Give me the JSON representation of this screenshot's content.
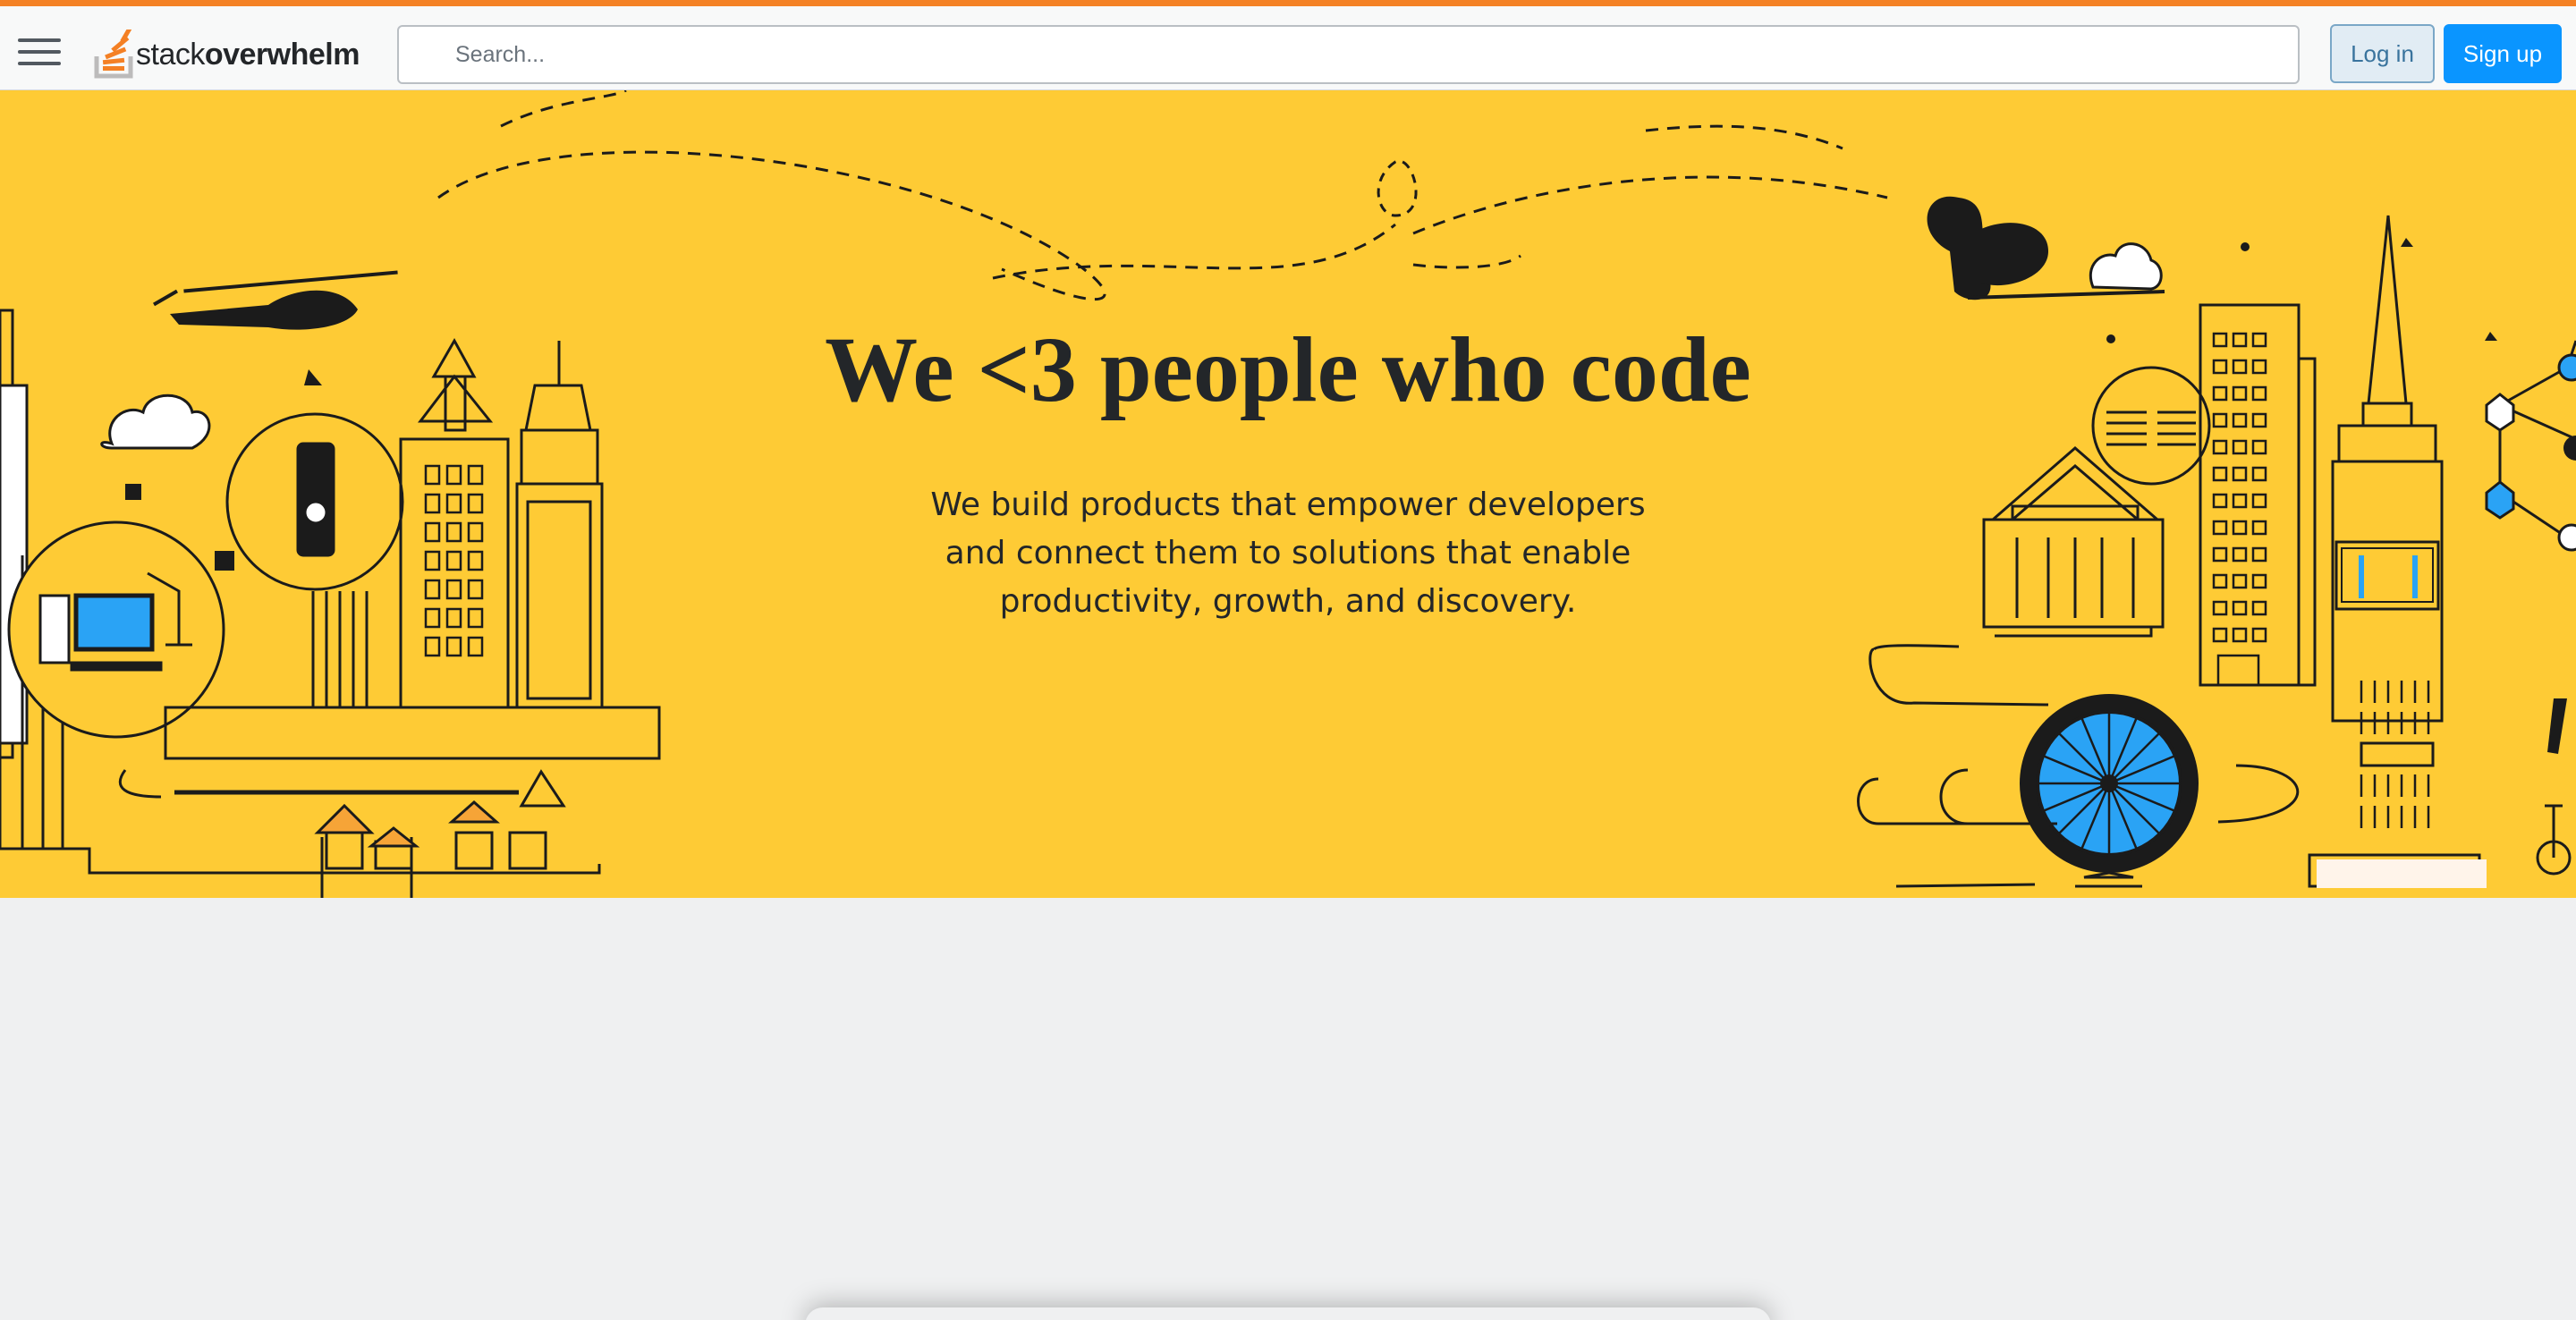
{
  "colors": {
    "accent_bar": "#f48225",
    "hero_background": "#fecb35",
    "page_background": "#eff0f1",
    "primary_button": "#0a95ff",
    "secondary_button": "#e1ecf4",
    "illustration_blue": "#2aa3f5"
  },
  "header": {
    "menu_icon": "hamburger-icon",
    "logo": {
      "word_light": "stack",
      "word_bold": "overwhelm",
      "icon": "stack-logo-icon"
    },
    "search": {
      "placeholder": "Search..."
    },
    "login_label": "Log in",
    "signup_label": "Sign up"
  },
  "hero": {
    "title": "We <3 people who code",
    "subtitle_lines": [
      "We build products that empower developers",
      "and connect them to solutions that enable",
      "productivity, growth, and discovery."
    ]
  }
}
